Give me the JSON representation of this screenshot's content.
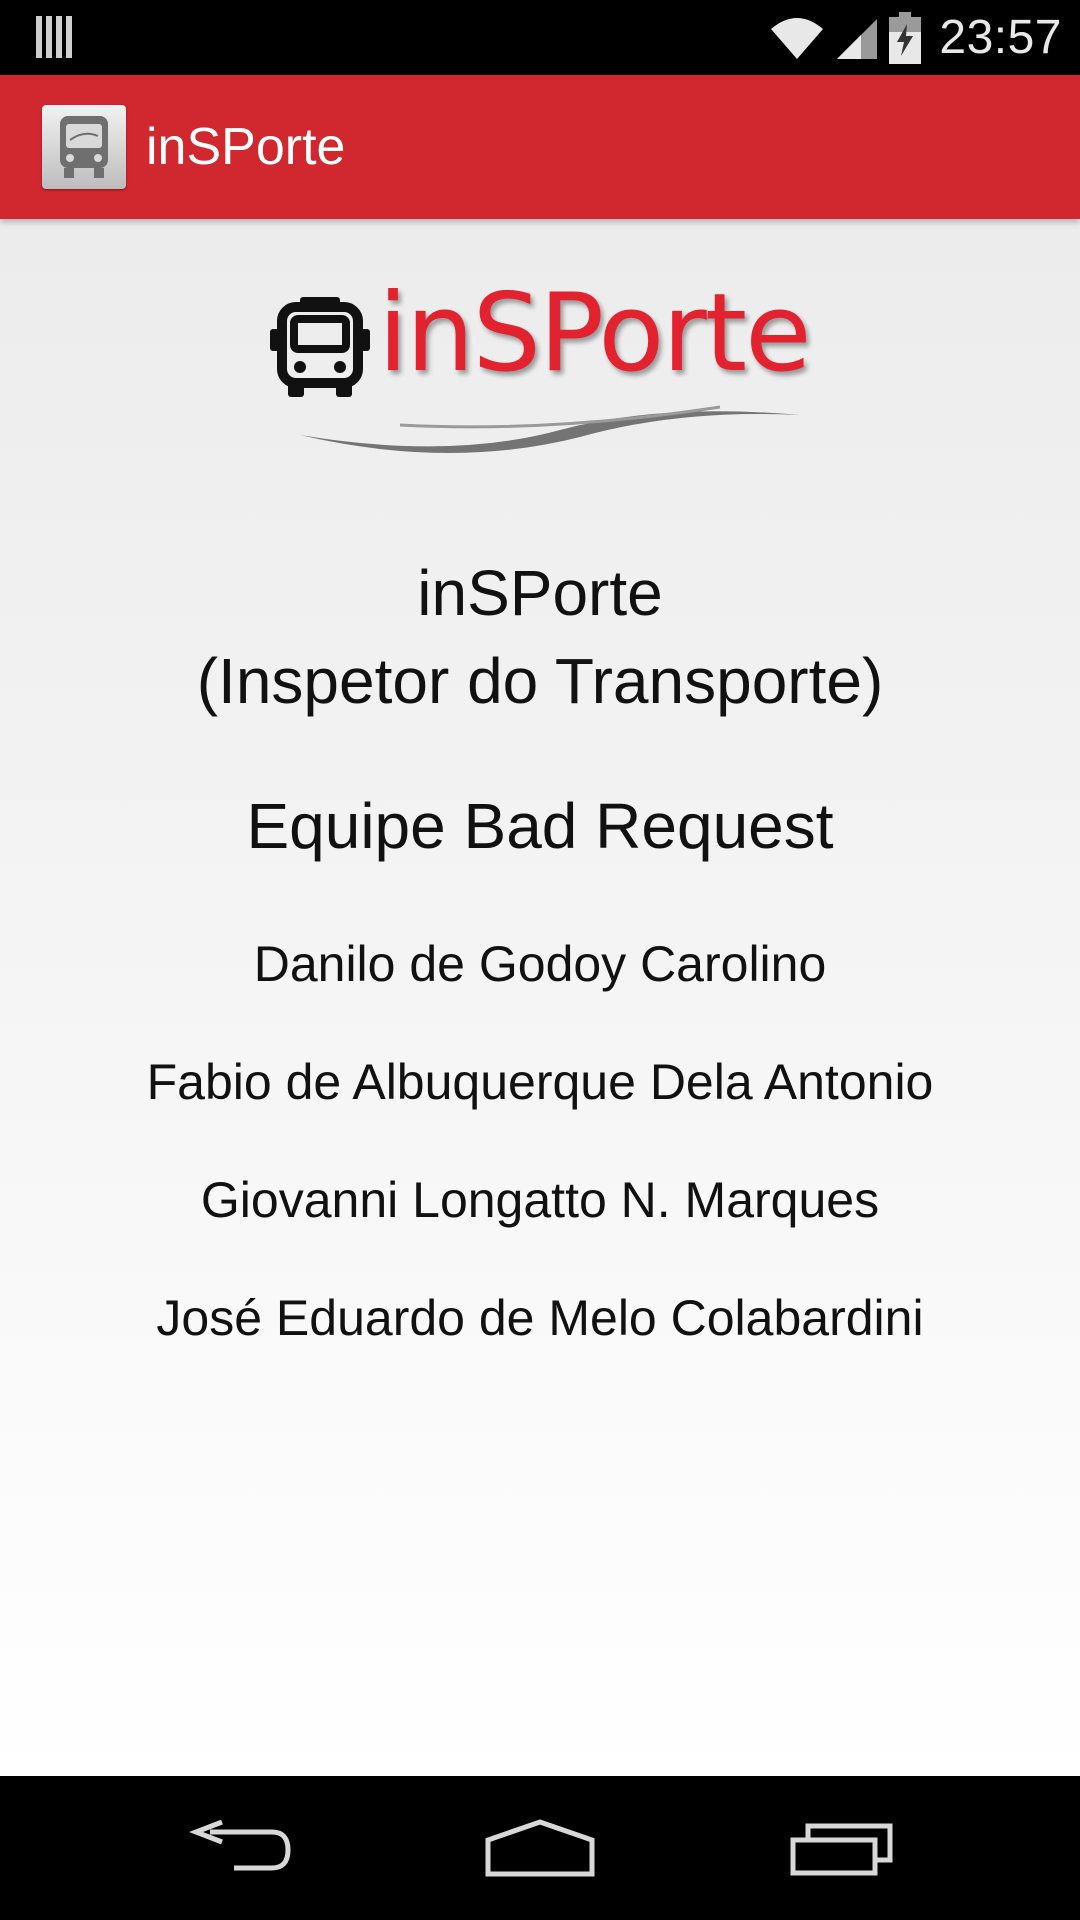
{
  "status_bar": {
    "time": "23:57",
    "icons": [
      "signal-bars-icon",
      "wifi-icon",
      "cell-signal-icon",
      "battery-charging-icon"
    ]
  },
  "action_bar": {
    "icon": "bus-icon",
    "title": "inSPorte"
  },
  "logo": {
    "icon": "bus-icon",
    "text": "inSPorte"
  },
  "about": {
    "app_name": "inSPorte",
    "app_full_name": "(Inspetor do Transporte)",
    "team": "Equipe Bad Request",
    "members": [
      "Danilo de Godoy Carolino",
      "Fabio de Albuquerque Dela Antonio",
      "Giovanni Longatto N. Marques",
      "José Eduardo de Melo Colabardini"
    ]
  },
  "nav_bar": {
    "buttons": [
      "back-icon",
      "home-icon",
      "recent-apps-icon"
    ]
  },
  "colors": {
    "action_bar": "#d1272f",
    "logo_red": "#e2232f"
  }
}
